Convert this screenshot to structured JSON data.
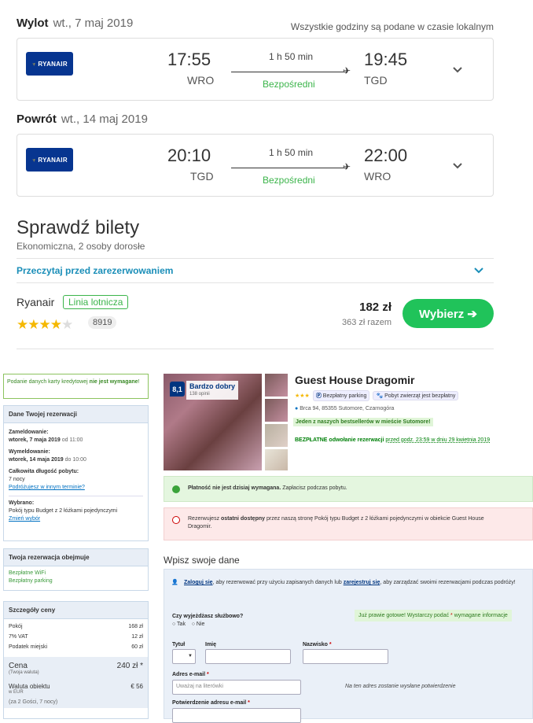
{
  "outbound": {
    "label": "Wylot",
    "date": "wt., 7 maj 2019",
    "airline": "RYANAIR",
    "dep_time": "17:55",
    "dep_code": "WRO",
    "duration": "1 h 50 min",
    "type": "Bezpośredni",
    "arr_time": "19:45",
    "arr_code": "TGD"
  },
  "timezone_note": "Wszystkie godziny są podane w czasie lokalnym",
  "return": {
    "label": "Powrót",
    "date": "wt., 14 maj 2019",
    "airline": "RYANAIR",
    "dep_time": "20:10",
    "dep_code": "TGD",
    "duration": "1 h 50 min",
    "type": "Bezpośredni",
    "arr_time": "22:00",
    "arr_code": "WRO"
  },
  "tickets": {
    "title": "Sprawdź bilety",
    "subtitle": "Ekonomiczna, 2 osoby dorosłe",
    "read_before": "Przeczytaj przed zarezerwowaniem",
    "provider": "Ryanair",
    "provider_badge": "Linia lotnicza",
    "rating_stars": 4,
    "rating_max": 5,
    "reviews": "8919",
    "price": "182 zł",
    "price_total": "363 zł razem",
    "select_label": "Wybierz ➔"
  },
  "booking": {
    "card_notice_pre": "Podanie danych karty kredytowej ",
    "card_notice_bold": "nie jest wymagane",
    "card_notice_post": "!",
    "details_header": "Dane Twojej rezerwacji",
    "checkin_label": "Zameldowanie:",
    "checkin_date": "wtorek, 7 maja 2019",
    "checkin_time": "od 11:00",
    "checkout_label": "Wymeldowanie:",
    "checkout_date": "wtorek, 14 maja 2019",
    "checkout_time": "do 10:00",
    "stay_label": "Całkowita długość pobytu:",
    "stay_value": "7 nocy",
    "change_dates": "Podróżujesz w innym terminie?",
    "selected_label": "Wybrano:",
    "selected_value": "Pokój typu Budget z 2 łóżkami pojedynczymi",
    "change_choice": "Zmień wybór",
    "includes_header": "Twoja rezerwacja obejmuje",
    "includes": [
      "Bezpłatne WiFi",
      "Bezpłatny parking"
    ],
    "price_header": "Szczegóły ceny",
    "price_rows": [
      {
        "label": "Pokój",
        "value": "168 zł"
      },
      {
        "label": "7% VAT",
        "value": "12 zł"
      },
      {
        "label": "Podatek miejski",
        "value": "60 zł"
      }
    ],
    "total_label": "Cena",
    "total_sub": "(Twoja waluta)",
    "total_value": "240 zł *",
    "local_label": "Waluta obiektu",
    "local_sub": "w EUR",
    "local_value": "€ 56",
    "guests_note": "(za 2 Gości, 7 nocy)"
  },
  "hotel": {
    "score": "8,1",
    "score_label": "Bardzo dobry",
    "reviews": "138 opinii",
    "name": "Guest House Dragomir",
    "stars": "★★★",
    "parking": "Bezpłatny parking",
    "pets": "Pobyt zwierząt jest bezpłatny",
    "address": "Brca 94, 85355 Sutomore, Czarnogóra",
    "bestseller": "Jeden z naszych bestsellerów w mieście Sutomore!",
    "free_cancel_bold": "BEZPŁATNE odwołanie rezerwacji",
    "free_cancel_rest": "przed godz. 23:59 w dniu 29 kwietnia 2019",
    "pay_bold": "Płatność nie jest dzisiaj wymagana.",
    "pay_rest": "Zapłacisz podczas pobytu.",
    "last_pre": "Rezerwujesz ",
    "last_bold": "ostatni dostępny",
    "last_rest": " przez naszą stronę Pokój typu Budget z 2 łóżkami pojedynczymi w obiekcie Guest House Dragomir."
  },
  "form": {
    "title": "Wpisz swoje dane",
    "login_link": "Zaloguj się",
    "login_mid": ", aby rezerwować przy użyciu zapisanych danych lub ",
    "register_link": "zarejestruj się",
    "login_end": ", aby zarządzać swoimi rezerwacjami podczas podróży!",
    "almost": "Już prawie gotowe! Wystarczy podać ",
    "almost_end": " wymagane informacje",
    "business_q": "Czy wyjeżdżasz służbowo?",
    "yes": "Tak",
    "no": "Nie",
    "title_label": "Tytuł",
    "first_label": "Imię",
    "last_label": "Nazwisko",
    "email_label": "Adres e-mail",
    "email_placeholder": "Uważaj na literówki",
    "email_note": "Na ten adres zostanie wysłane potwierdzenie",
    "confirm_label": "Potwierdzenie adresu e-mail"
  }
}
